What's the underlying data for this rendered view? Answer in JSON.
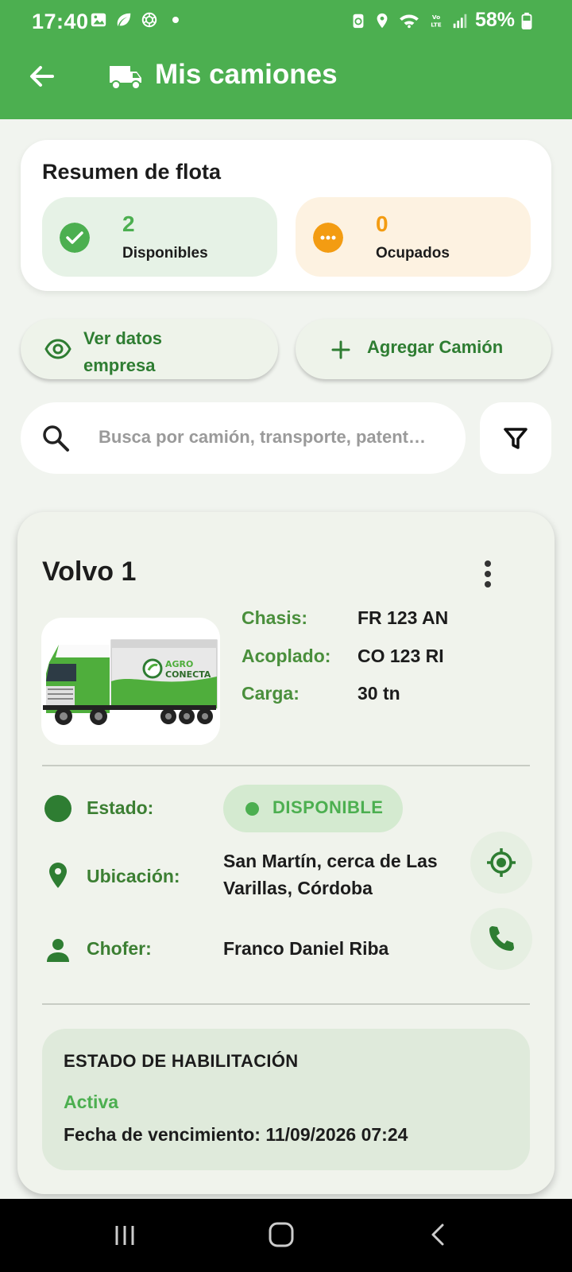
{
  "status_bar": {
    "time": "17:40",
    "battery": "58%",
    "left_icons": [
      "gallery-icon",
      "leaf-icon",
      "openai-icon"
    ],
    "right_icons": [
      "battery-saver-icon",
      "location-icon",
      "wifi-icon",
      "volte-icon",
      "signal-icon",
      "battery-icon"
    ]
  },
  "appbar": {
    "title": "Mis camiones",
    "color": "#4caf50",
    "icons": [
      "back-arrow-icon",
      "truck-icon"
    ]
  },
  "summary": {
    "title": "Resumen de flota",
    "available": {
      "value": "2",
      "label": "Disponibles",
      "icon": "check-circle-icon",
      "color": "#4caf50"
    },
    "busy": {
      "value": "0",
      "label": "Ocupados",
      "icon": "more-circle-icon",
      "color": "#f39c12"
    }
  },
  "actions": {
    "view_company": "Ver datos empresa",
    "add_truck": "Agregar Camión"
  },
  "search": {
    "placeholder": "Busca por camión, transporte, patent…"
  },
  "truck": {
    "name": "Volvo 1",
    "image_logo_line1": "AGRO",
    "image_logo_line2": "CONECTA",
    "specs": [
      {
        "label": "Chasis:",
        "value": "FR 123 AN"
      },
      {
        "label": "Acoplado:",
        "value": "CO 123 RI"
      },
      {
        "label": "Carga:",
        "value": "30 tn"
      }
    ],
    "status_label": "Estado:",
    "status_value": "DISPONIBLE",
    "location_label": "Ubicación:",
    "location_value": "San Martín, cerca de Las Varillas, Córdoba",
    "driver_label": "Chofer:",
    "driver_value": "Franco Daniel Riba",
    "habilitacion": {
      "title": "ESTADO DE HABILITACIÓN",
      "state": "Activa",
      "expiry": "Fecha de vencimiento: 11/09/2026 07:24"
    }
  },
  "navbar": {
    "icons": [
      "recent-apps-icon",
      "home-icon",
      "back-icon"
    ]
  }
}
